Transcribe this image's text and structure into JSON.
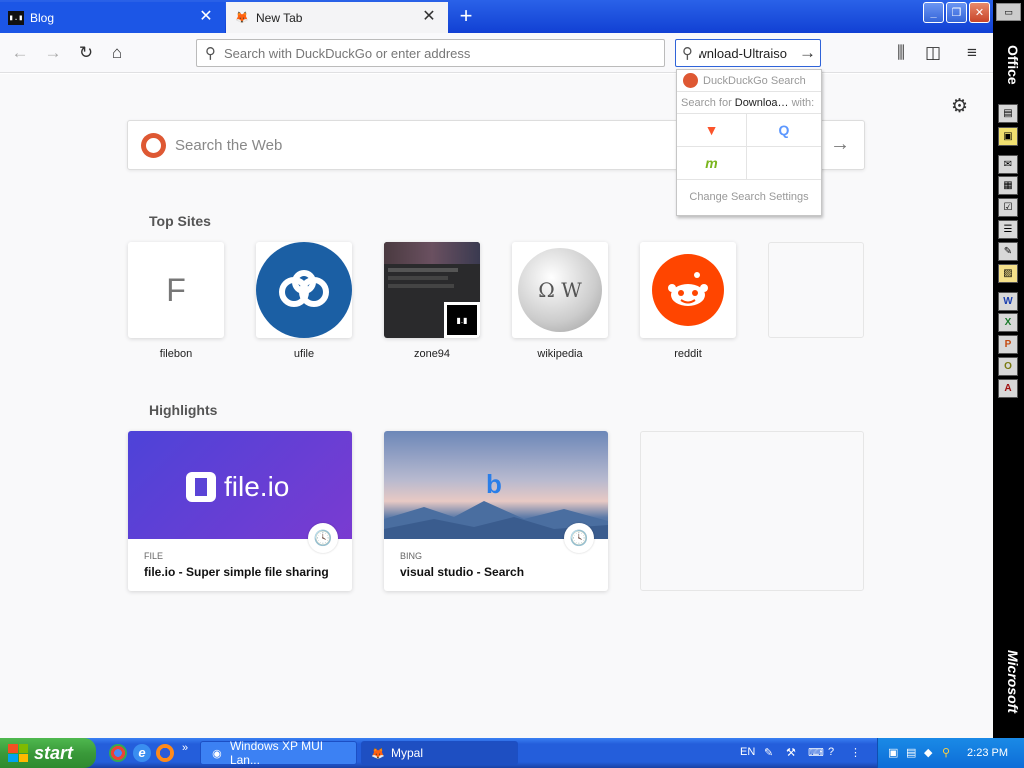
{
  "tabs": [
    {
      "label": "Blog",
      "favicon": "terminal-favicon"
    },
    {
      "label": "New Tab",
      "favicon": "firefox-favicon"
    }
  ],
  "navbar": {
    "url_placeholder": "Search with DuckDuckGo or enter address",
    "search_value": "wnload-Ultraiso"
  },
  "search_dropdown": {
    "engine_header": "DuckDuckGo Search",
    "search_for_prefix": "Search for",
    "search_for_term": "Downloa…",
    "search_for_suffix": "with:",
    "engines": [
      {
        "name": "brave-icon",
        "glyph": "▼",
        "color": "#fb542b"
      },
      {
        "name": "qwant-icon",
        "glyph": "Q",
        "color": "#5c97ff"
      },
      {
        "name": "mojeek-icon",
        "glyph": "m",
        "color": "#7ab51d"
      },
      {
        "name": "empty-slot",
        "glyph": "",
        "color": "#ffffff"
      }
    ],
    "settings_label": "Change Search Settings"
  },
  "content": {
    "search_placeholder": "Search the Web",
    "top_sites_title": "Top Sites",
    "top_sites": [
      {
        "label": "filebon",
        "letter": "F"
      },
      {
        "label": "ufile"
      },
      {
        "label": "zone94"
      },
      {
        "label": "wikipedia"
      },
      {
        "label": "reddit"
      },
      {
        "label": ""
      }
    ],
    "highlights_title": "Highlights",
    "highlights": [
      {
        "source": "FILE",
        "title": "file.io - Super simple file sharing",
        "logo_text": "file.io"
      },
      {
        "source": "BING",
        "title": "visual studio - Search"
      }
    ]
  },
  "officebar": {
    "label": "Office",
    "brand": "Microsoft"
  },
  "taskbar": {
    "start_label": "start",
    "windows": [
      {
        "label": "Windows XP MUI Lan..."
      },
      {
        "label": "Mypal"
      }
    ],
    "language": "EN",
    "time": "2:23 PM"
  },
  "colors": {
    "accent": "#2f63d8",
    "ddg": "#de5833",
    "reddit": "#ff4500",
    "ufile": "#1b5fa4"
  }
}
